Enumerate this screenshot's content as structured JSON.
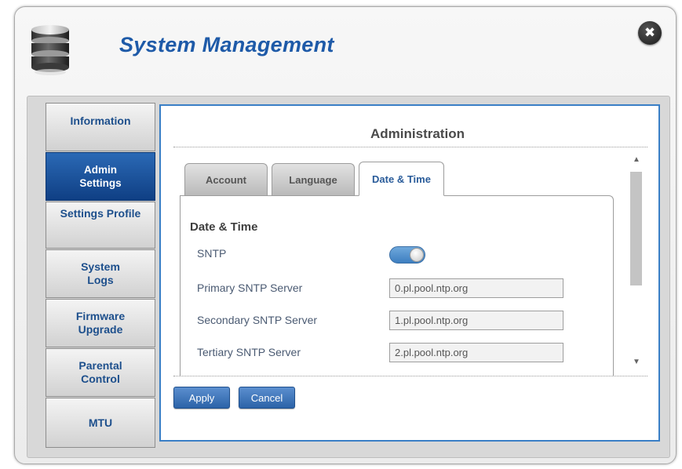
{
  "header": {
    "title": "System Management",
    "logo_icon": "database-icon",
    "close_icon": "close-icon",
    "close_glyph": "✖"
  },
  "sidebar": {
    "items": [
      {
        "label": "Information",
        "active": false
      },
      {
        "label": "Admin Settings",
        "active": true
      },
      {
        "label": "Settings Profile",
        "active": false
      },
      {
        "label": "System Logs",
        "active": false
      },
      {
        "label": "Firmware Upgrade",
        "active": false
      },
      {
        "label": "Parental Control",
        "active": false
      },
      {
        "label": "MTU",
        "active": false
      }
    ]
  },
  "main": {
    "section_title": "Administration",
    "tabs": [
      {
        "label": "Account",
        "active": false
      },
      {
        "label": "Language",
        "active": false
      },
      {
        "label": "Date & Time",
        "active": true
      }
    ],
    "panel": {
      "heading": "Date & Time",
      "sntp": {
        "label": "SNTP",
        "enabled": true
      },
      "fields": [
        {
          "label": "Primary SNTP Server",
          "value": "0.pl.pool.ntp.org"
        },
        {
          "label": "Secondary SNTP Server",
          "value": "1.pl.pool.ntp.org"
        },
        {
          "label": "Tertiary SNTP Server",
          "value": "2.pl.pool.ntp.org"
        }
      ]
    },
    "buttons": {
      "apply": "Apply",
      "cancel": "Cancel"
    },
    "scroll": {
      "up_glyph": "▲",
      "down_glyph": "▼"
    }
  },
  "colors": {
    "accent": "#1e5aa8",
    "active_nav": "#1a4f96",
    "content_border": "#3a7fc6",
    "button": "#3a70b6"
  }
}
